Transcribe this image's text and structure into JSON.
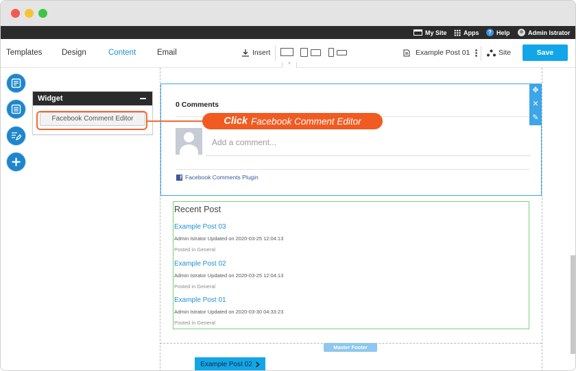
{
  "adminbar": {
    "my_site": "My Site",
    "apps": "Apps",
    "help": "Help",
    "help_icon_glyph": "?",
    "user": "Admin Istrator"
  },
  "toolbar": {
    "tabs": [
      {
        "label": "Templates",
        "active": false
      },
      {
        "label": "Design",
        "active": false
      },
      {
        "label": "Content",
        "active": true
      },
      {
        "label": "Email",
        "active": false
      }
    ],
    "insert": "Insert",
    "page_name": "Example Post 01",
    "site": "Site",
    "save": "Save"
  },
  "widget_panel": {
    "title": "Widget",
    "button_label": "Facebook Comment Editor"
  },
  "callout": {
    "action": "Click",
    "target": "Facebook Comment Editor",
    "color": "#f15b22"
  },
  "fb_comments": {
    "count_label": "0 Comments",
    "input_placeholder": "Add a comment...",
    "plugin_label": "Facebook Comments Plugin",
    "logo_glyph": "f"
  },
  "recent_post": {
    "title": "Recent Post",
    "posts": [
      {
        "title": "Example Post 03",
        "meta": "Admin Istrator Updated on 2020-03-25 12:04:13",
        "category": "Posted in General"
      },
      {
        "title": "Example Post 02",
        "meta": "Admin Istrator Updated on 2020-03-25 12:04:13",
        "category": "Posted in General"
      },
      {
        "title": "Example Post 01",
        "meta": "Admin Istrator Updated on 2020-03-30 04:33:23",
        "category": "Posted in General"
      }
    ]
  },
  "footer": {
    "badge": "Master Footer",
    "next_post": "Example Post 02"
  },
  "colors": {
    "accent": "#12a6e8",
    "selection": "#3ea5e8",
    "side_buttons": "#1e86cc",
    "recent_border": "#7ad07a"
  },
  "icons": {
    "sidebar": [
      "panel-layout-icon",
      "module-list-icon",
      "edit-text-icon",
      "add-plus-icon"
    ],
    "devices": [
      "desktop-icon",
      "tablet-icon",
      "mobile-icon"
    ],
    "block_controls": [
      "move-icon",
      "close-icon",
      "edit-pen-icon"
    ]
  }
}
